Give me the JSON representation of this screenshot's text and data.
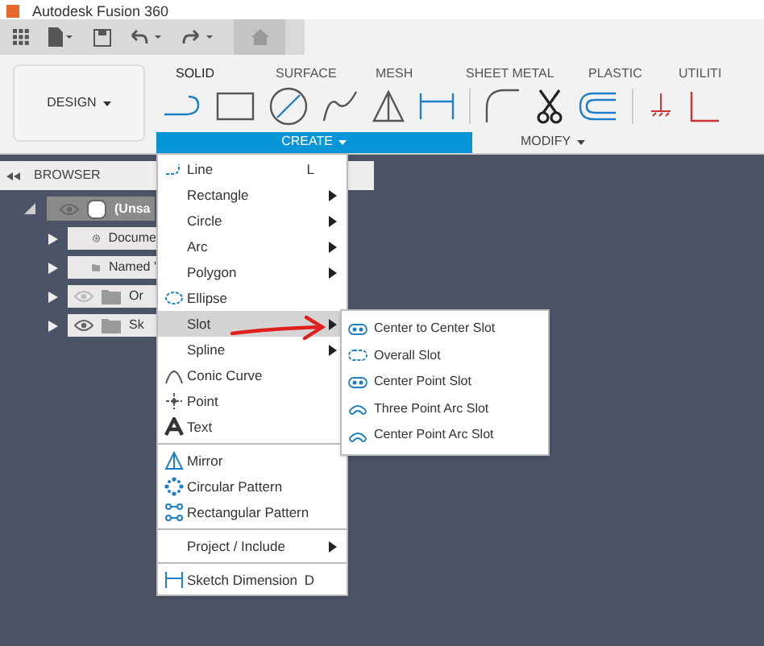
{
  "window": {
    "title": "Autodesk Fusion 360"
  },
  "workspace": {
    "label": "DESIGN"
  },
  "ribbon_tabs": [
    {
      "label": "SOLID",
      "selected": true
    },
    {
      "label": "SURFACE",
      "selected": false
    },
    {
      "label": "MESH",
      "selected": false
    },
    {
      "label": "SHEET METAL",
      "selected": false
    },
    {
      "label": "PLASTIC",
      "selected": false
    },
    {
      "label": "UTILITI",
      "selected": false
    }
  ],
  "ribbon_groups": [
    {
      "label": "CREATE",
      "selected": true
    },
    {
      "label": "MODIFY",
      "selected": false
    }
  ],
  "browser": {
    "title": "BROWSER",
    "items": [
      {
        "label": "(Unsa",
        "kind": "document",
        "visible": true,
        "selected": true,
        "children": [
          {
            "label": "Docume",
            "kind": "gear",
            "selected": false
          },
          {
            "label": "Named '",
            "kind": "folder",
            "selected": false
          },
          {
            "label": "Or",
            "kind": "folder",
            "visible": false,
            "selected": false
          },
          {
            "label": "Sk",
            "kind": "folder",
            "visible": true,
            "selected": false
          }
        ]
      }
    ]
  },
  "create_menu": [
    [
      {
        "label": "Line",
        "shortcut": "L",
        "submenu": false,
        "kind": "line",
        "selected": false
      },
      {
        "label": "Rectangle",
        "submenu": true,
        "selected": false
      },
      {
        "label": "Circle",
        "submenu": true,
        "selected": false
      },
      {
        "label": "Arc",
        "submenu": true,
        "selected": false
      },
      {
        "label": "Polygon",
        "submenu": true,
        "selected": false
      },
      {
        "label": "Ellipse",
        "submenu": false,
        "kind": "ellipse",
        "selected": false
      },
      {
        "label": "Slot",
        "submenu": true,
        "selected": true
      },
      {
        "label": "Spline",
        "submenu": true,
        "selected": false
      },
      {
        "label": "Conic Curve",
        "submenu": false,
        "kind": "conic",
        "selected": false
      },
      {
        "label": "Point",
        "submenu": false,
        "kind": "point",
        "selected": false
      },
      {
        "label": "Text",
        "submenu": false,
        "kind": "text",
        "selected": false
      }
    ],
    [
      {
        "label": "Mirror",
        "submenu": false,
        "kind": "mirror",
        "selected": false
      },
      {
        "label": "Circular Pattern",
        "submenu": false,
        "kind": "circular",
        "selected": false
      },
      {
        "label": "Rectangular Pattern",
        "submenu": false,
        "kind": "rectangular",
        "selected": false
      }
    ],
    [
      {
        "label": "Project / Include",
        "submenu": true,
        "selected": false
      }
    ],
    [
      {
        "label": "Sketch Dimension",
        "shortcut": "D",
        "submenu": false,
        "kind": "dimension",
        "selected": false
      }
    ]
  ],
  "slot_submenu": [
    {
      "label": "Center to Center Slot",
      "kind": "slot"
    },
    {
      "label": "Overall Slot",
      "kind": "overall"
    },
    {
      "label": "Center Point Slot",
      "kind": "slot"
    },
    {
      "label": "Three Point Arc Slot",
      "kind": "arc"
    },
    {
      "label": "Center Point Arc Slot",
      "kind": "arc"
    }
  ]
}
